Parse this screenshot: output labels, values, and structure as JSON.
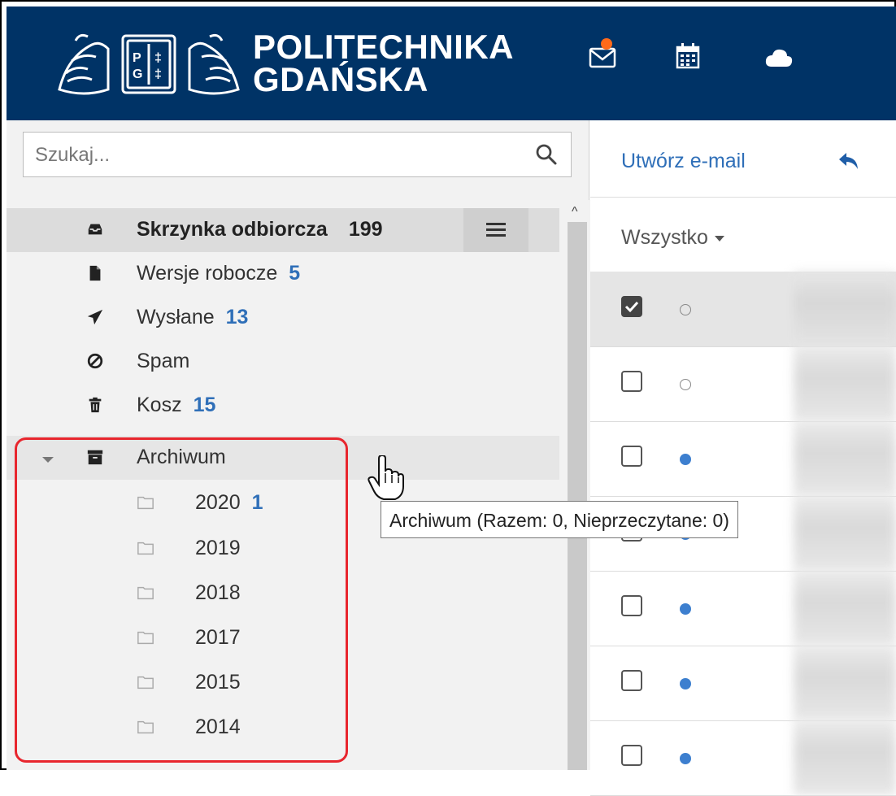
{
  "header": {
    "brand_line1": "POLITECHNIKA",
    "brand_line2": "GDAŃSKA",
    "bg_color": "#003366",
    "icons": [
      "mail-icon",
      "calendar-icon",
      "cloud-icon"
    ],
    "mail_notification": true
  },
  "search": {
    "placeholder": "Szukaj..."
  },
  "folders": [
    {
      "label": "Skrzynka odbiorcza",
      "count": "199",
      "icon": "inbox-icon",
      "active": true
    },
    {
      "label": "Wersje robocze",
      "count": "5",
      "icon": "file-icon"
    },
    {
      "label": "Wysłane",
      "count": "13",
      "icon": "send-icon"
    },
    {
      "label": "Spam",
      "count": "",
      "icon": "ban-icon"
    },
    {
      "label": "Kosz",
      "count": "15",
      "icon": "trash-icon"
    },
    {
      "label": "Archiwum",
      "count": "",
      "icon": "archive-icon",
      "expanded": true
    }
  ],
  "archive_subfolders": [
    {
      "label": "2020",
      "count": "1"
    },
    {
      "label": "2019",
      "count": ""
    },
    {
      "label": "2018",
      "count": ""
    },
    {
      "label": "2017",
      "count": ""
    },
    {
      "label": "2015",
      "count": ""
    },
    {
      "label": "2014",
      "count": ""
    }
  ],
  "toolbar": {
    "compose_label": "Utwórz e-mail"
  },
  "list": {
    "filter_label": "Wszystko"
  },
  "messages": [
    {
      "checked": true,
      "unread": false
    },
    {
      "checked": false,
      "unread": false
    },
    {
      "checked": false,
      "unread": true
    },
    {
      "checked": false,
      "unread": true
    },
    {
      "checked": false,
      "unread": true
    },
    {
      "checked": false,
      "unread": true
    },
    {
      "checked": false,
      "unread": true
    }
  ],
  "tooltip": {
    "text": "Archiwum (Razem: 0, Nieprzeczytane: 0)"
  },
  "colors": {
    "accent": "#2f6fb8",
    "highlight_box": "#e8262e",
    "notification": "#ff6a1a"
  }
}
